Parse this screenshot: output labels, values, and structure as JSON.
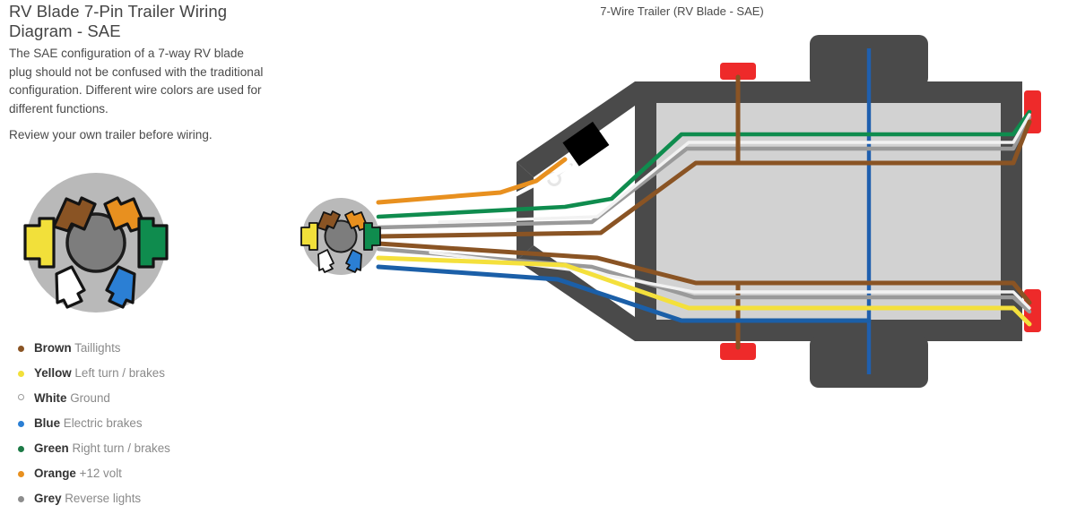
{
  "page": {
    "title": "RV Blade 7-Pin Trailer Wiring Diagram - SAE",
    "intro": "The SAE configuration of a 7-way RV blade plug should not be confused with the traditional configuration. Different wire colors are used for different functions.",
    "review_note": "Review your own trailer before wiring."
  },
  "colors": {
    "brown": "#8a5424",
    "yellow": "#f4e03c",
    "white": "#ffffff",
    "blue": "#1b5fa8",
    "green": "#0f8c4e",
    "orange": "#e8901f",
    "grey": "#9a9a9a",
    "frame_dark": "#4a4a4a",
    "bed_light": "#d2d2d2",
    "lamp_red": "#ee2a2a",
    "axle_blue": "#1f5fae",
    "battery_box": "#000000",
    "plug_body": "#b9b9b9",
    "plug_center": "#7d7d7d"
  },
  "legend": {
    "items": [
      {
        "name": "Brown",
        "desc": "Taillights",
        "color": "#8a5424",
        "hollow": false
      },
      {
        "name": "Yellow",
        "desc": "Left turn / brakes",
        "color": "#f2e03a",
        "hollow": false
      },
      {
        "name": "White",
        "desc": "Ground",
        "color": "#ffffff",
        "hollow": true
      },
      {
        "name": "Blue",
        "desc": "Electric brakes",
        "color": "#2b7fd4",
        "hollow": false
      },
      {
        "name": "Green",
        "desc": "Right turn / brakes",
        "color": "#1d7a46",
        "hollow": false
      },
      {
        "name": "Orange",
        "desc": "+12 volt",
        "color": "#e8901f",
        "hollow": false
      },
      {
        "name": "Grey",
        "desc": "Reverse lights",
        "color": "#8d8d8d",
        "hollow": false
      }
    ]
  },
  "plug": {
    "label": "7-pin RV blade connector",
    "pins": [
      {
        "position": "upper-left",
        "color": "#8a5424",
        "function": "Taillights"
      },
      {
        "position": "upper-right",
        "color": "#e8901f",
        "function": "+12 volt"
      },
      {
        "position": "left",
        "color": "#f2e03a",
        "function": "Left turn / brakes"
      },
      {
        "position": "right",
        "color": "#0f8c4e",
        "function": "Right turn / brakes"
      },
      {
        "position": "lower-left",
        "color": "#ffffff",
        "function": "Ground"
      },
      {
        "position": "lower-right",
        "color": "#2b7fd4",
        "function": "Electric brakes"
      },
      {
        "position": "center",
        "color": "#7d7d7d",
        "function": "Reverse lights"
      }
    ]
  },
  "trailer": {
    "caption": "7-Wire Trailer (RV Blade - SAE)",
    "lamps": [
      {
        "name": "front-left-marker-lamp",
        "color": "#ee2a2a"
      },
      {
        "name": "front-right-marker-lamp",
        "color": "#ee2a2a"
      },
      {
        "name": "rear-right-tail-lamp",
        "color": "#ee2a2a"
      },
      {
        "name": "rear-left-tail-lamp",
        "color": "#ee2a2a"
      }
    ],
    "components": [
      {
        "name": "battery-box",
        "color": "#000000"
      },
      {
        "name": "ground-ring-terminal",
        "color": "#e8e8e8"
      },
      {
        "name": "axle",
        "color": "#1f5fae"
      },
      {
        "name": "trailer-bed",
        "color": "#d2d2d2"
      },
      {
        "name": "trailer-frame",
        "color": "#4a4a4a"
      }
    ],
    "wires": [
      {
        "name": "orange-wire",
        "color": "#e8901f",
        "function": "+12 volt to battery box"
      },
      {
        "name": "white-wire",
        "color": "#ffffff",
        "function": "Ground to frame"
      },
      {
        "name": "green-wire",
        "color": "#0f8c4e",
        "function": "Right turn / brakes"
      },
      {
        "name": "brown-wire",
        "color": "#8a5424",
        "function": "Taillights"
      },
      {
        "name": "grey-wire",
        "color": "#9a9a9a",
        "function": "Reverse lights"
      },
      {
        "name": "yellow-wire",
        "color": "#f4e03c",
        "function": "Left turn / brakes"
      },
      {
        "name": "blue-wire",
        "color": "#1b5fa8",
        "function": "Electric brakes"
      }
    ]
  }
}
